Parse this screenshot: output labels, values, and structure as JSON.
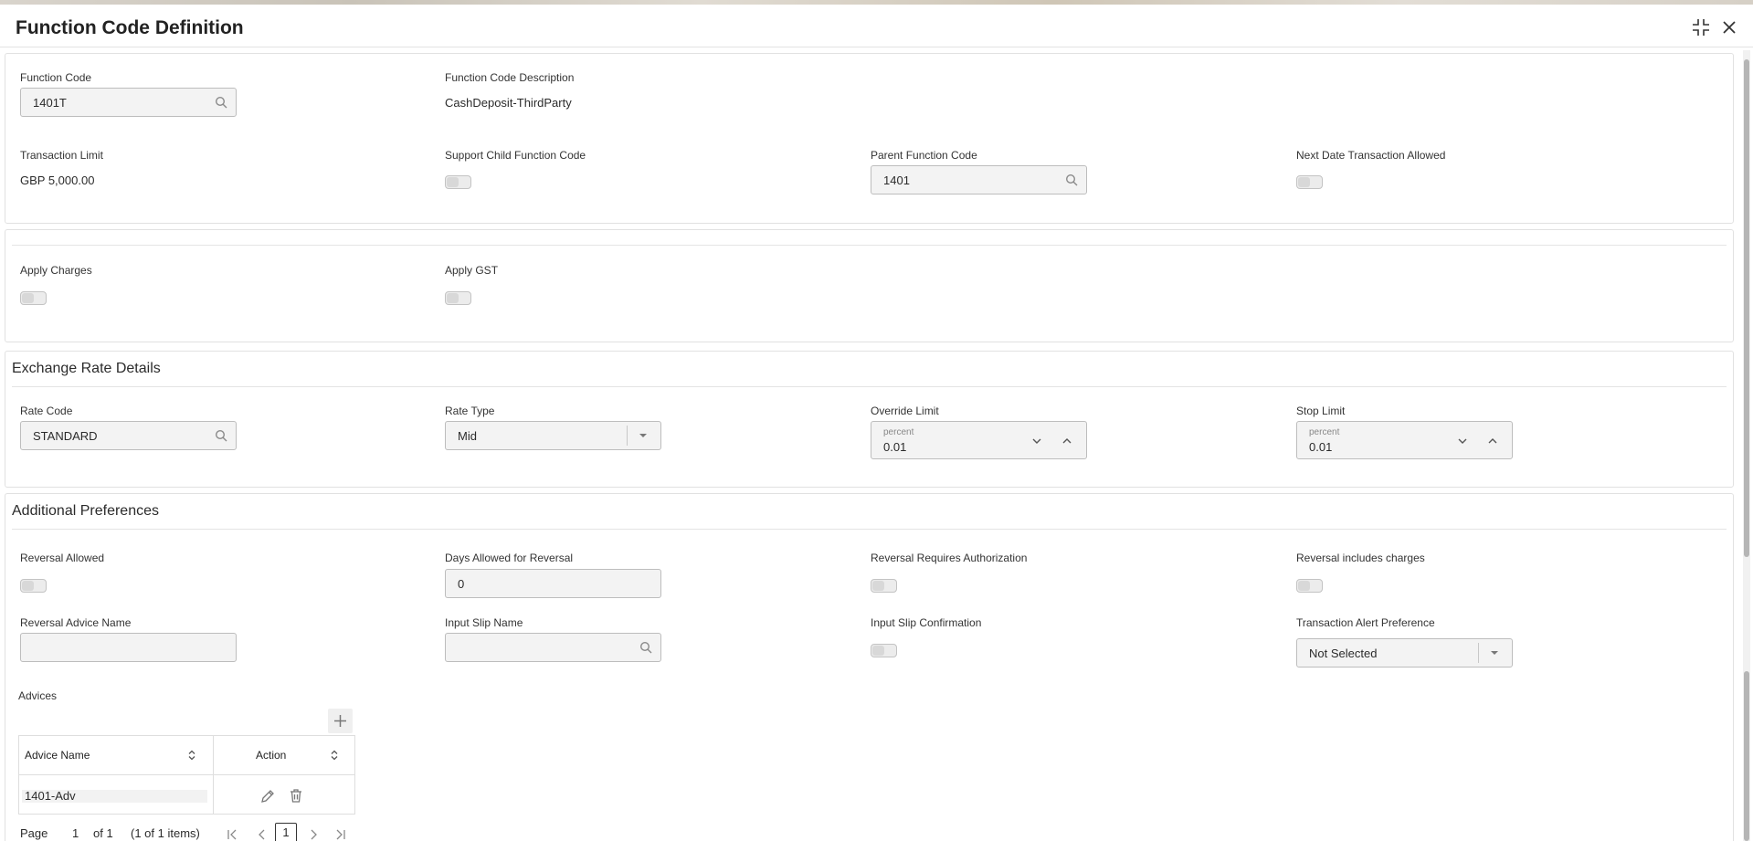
{
  "header": {
    "title": "Function Code Definition",
    "icons": [
      "collapse-icon",
      "close-icon"
    ]
  },
  "basic": {
    "function_code_label": "Function Code",
    "function_code_value": "1401T",
    "description_label": "Function Code Description",
    "description_value": "CashDeposit-ThirdParty",
    "transaction_limit_label": "Transaction Limit",
    "transaction_limit_value": "GBP 5,000.00",
    "support_child_label": "Support Child Function Code",
    "parent_function_label": "Parent Function Code",
    "parent_function_value": "1401",
    "next_date_label": "Next Date Transaction Allowed"
  },
  "charges": {
    "apply_charges_label": "Apply Charges",
    "apply_gst_label": "Apply GST"
  },
  "exchange": {
    "title": "Exchange Rate Details",
    "rate_code_label": "Rate Code",
    "rate_code_value": "STANDARD",
    "rate_type_label": "Rate Type",
    "rate_type_value": "Mid",
    "override_limit_label": "Override Limit",
    "override_limit_unit": "percent",
    "override_limit_value": "0.01",
    "stop_limit_label": "Stop Limit",
    "stop_limit_unit": "percent",
    "stop_limit_value": "0.01"
  },
  "additional": {
    "title": "Additional Preferences",
    "reversal_allowed_label": "Reversal Allowed",
    "days_allowed_label": "Days Allowed for Reversal",
    "days_allowed_value": "0",
    "reversal_auth_label": "Reversal Requires Authorization",
    "reversal_charges_label": "Reversal includes charges",
    "reversal_advice_label": "Reversal Advice Name",
    "reversal_advice_value": "",
    "input_slip_label": "Input Slip Name",
    "input_slip_value": "",
    "input_slip_confirm_label": "Input Slip Confirmation",
    "alert_pref_label": "Transaction Alert Preference",
    "alert_pref_value": "Not Selected"
  },
  "advices": {
    "title": "Advices",
    "columns": [
      "Advice Name",
      "Action"
    ],
    "rows": [
      {
        "advice_name": "1401-Adv"
      }
    ],
    "pager": {
      "page_label": "Page",
      "page_value": "1",
      "of_label": "of 1",
      "items_label": "(1 of 1 items)",
      "current_page": "1"
    }
  },
  "colors": {
    "field_bg": "#f3f3f3",
    "border": "#bdbdbd",
    "text": "#2b2b2b"
  }
}
